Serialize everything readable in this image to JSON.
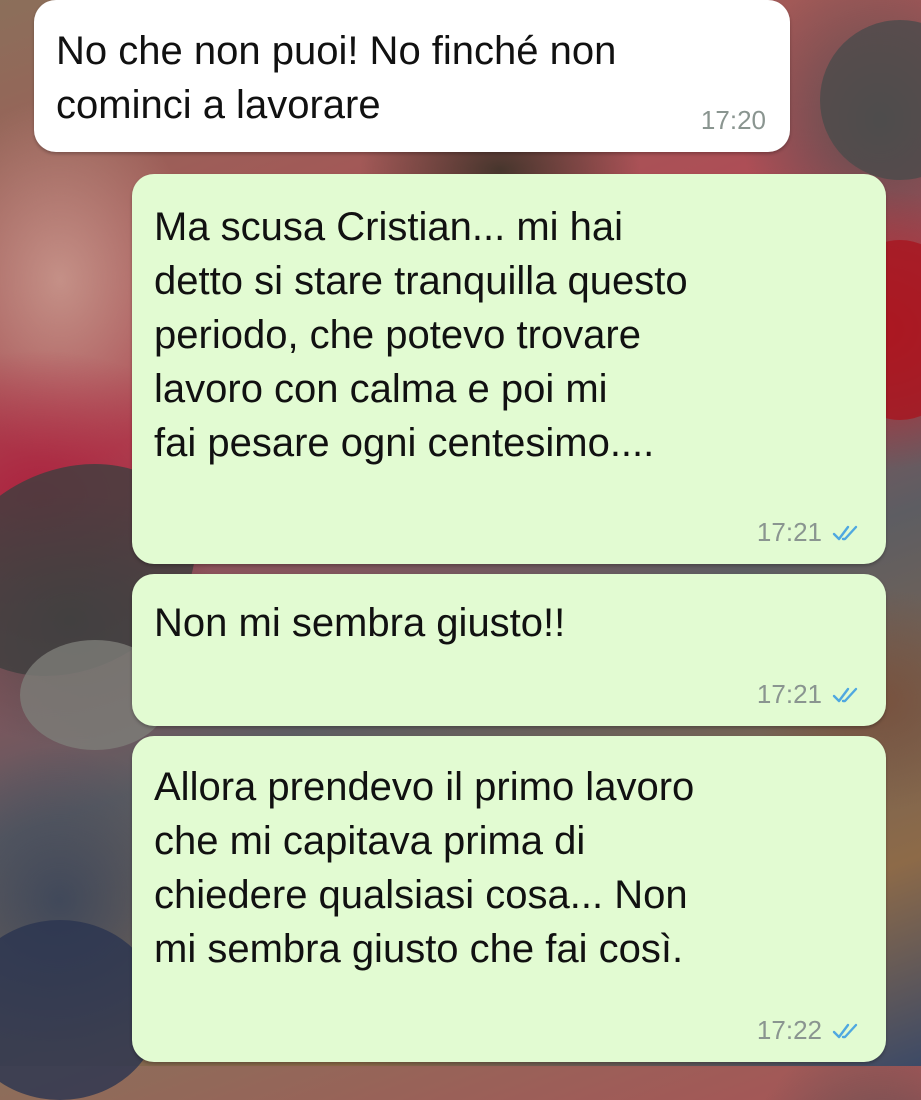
{
  "messages": [
    {
      "direction": "incoming",
      "text": "No che non puoi! No finché non\ncominci a lavorare",
      "time": "17:20"
    },
    {
      "direction": "outgoing",
      "text": "Ma scusa Cristian... mi hai\ndetto si stare tranquilla questo\nperiodo, che potevo trovare\nlavoro con calma e poi mi\nfai pesare ogni centesimo....",
      "time": "17:21",
      "status_icon": "double-check-icon"
    },
    {
      "direction": "outgoing",
      "text": "Non mi sembra giusto!!",
      "time": "17:21",
      "status_icon": "double-check-icon"
    },
    {
      "direction": "outgoing",
      "text": "Allora prendevo il primo lavoro\nche mi capitava prima di\nchiedere qualsiasi cosa... Non\nmi sembra giusto che fai così.",
      "time": "17:22",
      "status_icon": "double-check-icon"
    }
  ],
  "colors": {
    "incoming_bubble": "#ffffff",
    "outgoing_bubble": "#e2fbd2",
    "read_ticks": "#4fa8e0",
    "timestamp": "#8a9590"
  }
}
